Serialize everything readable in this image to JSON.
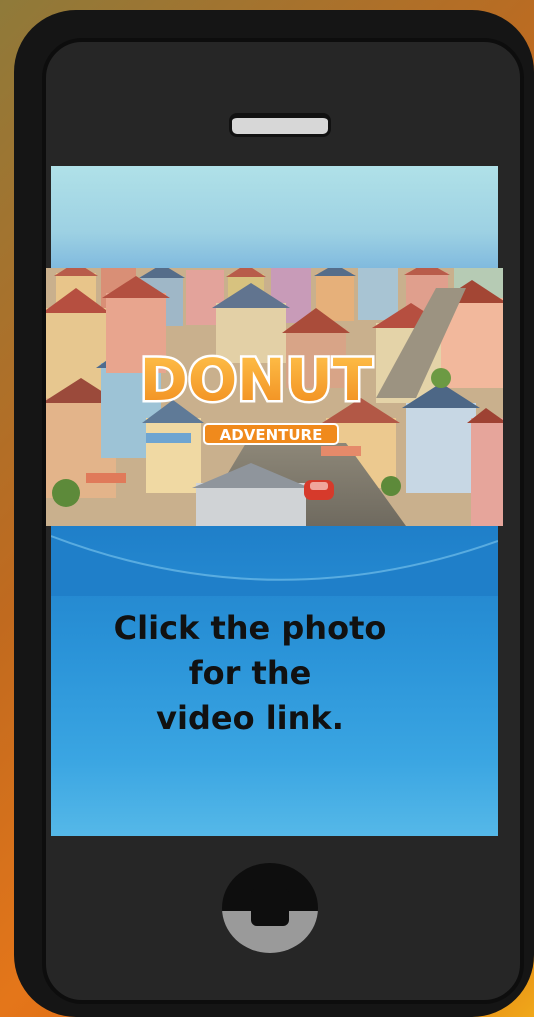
{
  "photo": {
    "title_line1": "DONUT",
    "title_line2": "ADVENTURE"
  },
  "caption": {
    "line1": "Click the photo",
    "line2": "for the",
    "line3": "video link."
  },
  "colors": {
    "background_accent": "#e4761a",
    "phone_body": "#151515",
    "screen_blue": "#2a93d8",
    "screen_sky": "#a9dfe6",
    "caption_text": "#111111"
  },
  "icons": [
    "speaker-grille",
    "home-button-icon"
  ]
}
